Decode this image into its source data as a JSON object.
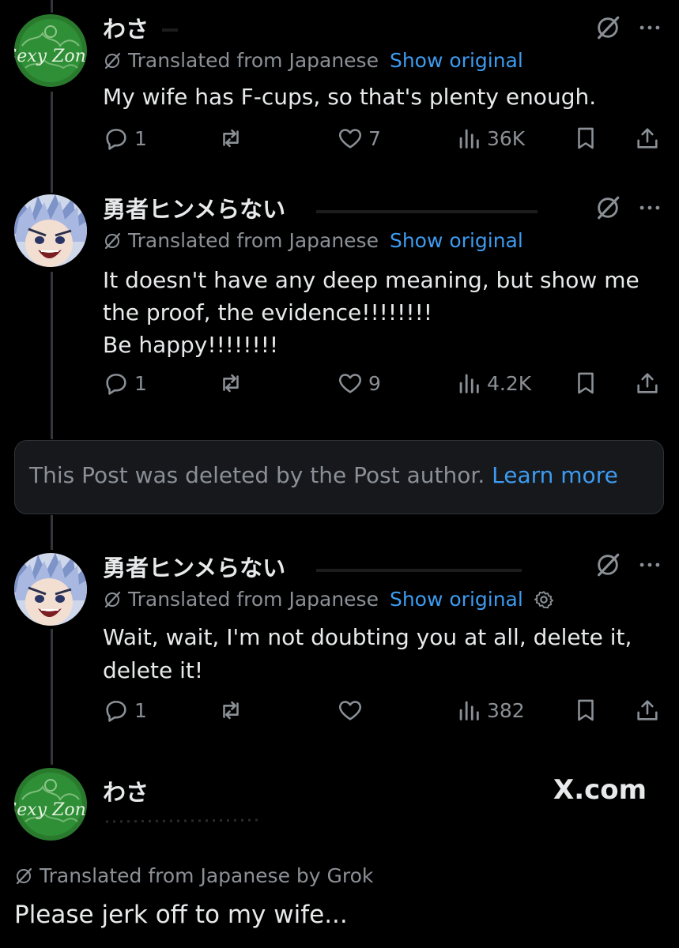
{
  "posts": [
    {
      "author": "わさ",
      "avatar": "sexy-zone-logo",
      "translated_label": "Translated from Japanese",
      "show_original": "Show original",
      "text": [
        "My wife has F-cups, so that's plenty enough."
      ],
      "replies": "1",
      "reposts": "",
      "likes": "7",
      "views": "36K"
    },
    {
      "author": "勇者ヒンメらない",
      "avatar": "anime-character",
      "translated_label": "Translated from Japanese",
      "show_original": "Show original",
      "text": [
        "It doesn't have any deep meaning, but show me",
        "the proof, the evidence!!!!!!!!",
        "Be happy!!!!!!!!"
      ],
      "replies": "1",
      "reposts": "",
      "likes": "9",
      "views": "4.2K"
    },
    {
      "author": "勇者ヒンメらない",
      "avatar": "anime-character",
      "translated_label": "Translated from Japanese",
      "show_original": "Show original",
      "text": [
        "Wait, wait, I'm not doubting you at all, delete it,",
        "delete it!"
      ],
      "replies": "1",
      "reposts": "",
      "likes": "",
      "views": "382"
    }
  ],
  "deleted_notice": {
    "message": "This Post was deleted by the Post author.",
    "link": "Learn more"
  },
  "final_post": {
    "author": "わさ",
    "avatar_text": "Sexy Zone",
    "site": "X.com",
    "translated_label": "Translated from Japanese by Grok",
    "text": "Please jerk off to my wife..."
  },
  "colors": {
    "background": "#000000",
    "text": "#e7e9ea",
    "muted": "#8b9096",
    "link": "#3d9bf0"
  }
}
